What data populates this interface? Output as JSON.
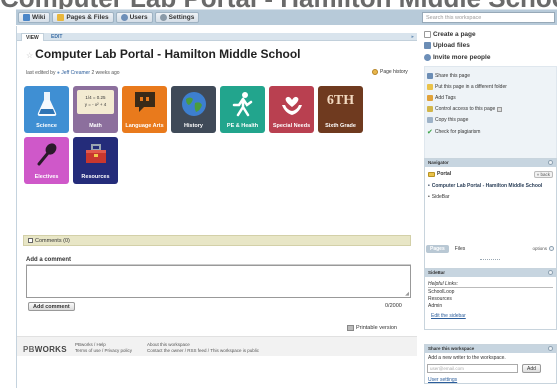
{
  "header": {
    "ghost_text": "Computer Lab Portal - Hamilton Middle School"
  },
  "topbar": {
    "tabs": [
      {
        "label": "Wiki",
        "icon": "wiki-icon",
        "color": "#4a86c8"
      },
      {
        "label": "Pages & Files",
        "icon": "folder-icon",
        "color": "#e9b73b"
      },
      {
        "label": "Users",
        "icon": "users-icon",
        "color": "#6d8fb8"
      },
      {
        "label": "Settings",
        "icon": "settings-icon",
        "color": "#8a9aa8"
      }
    ],
    "search_placeholder": "Search this workspace"
  },
  "view_tabs": {
    "view": "VIEW",
    "edit": "EDIT"
  },
  "page": {
    "title": "Computer Lab Portal - Hamilton Middle School",
    "last_edited_prefix": "last edited by",
    "last_edited_user": "Jeff Creamer",
    "last_edited_when": "2 weeks ago",
    "page_history": "Page history"
  },
  "tiles": [
    {
      "label": "Science",
      "color": "#3f8fd3"
    },
    {
      "label": "Math",
      "color": "#8c6f9d",
      "formula1": "1/4 = 0.25",
      "formula2": "y = - x² + 4"
    },
    {
      "label": "Language Arts",
      "color": "#e97a1c"
    },
    {
      "label": "History",
      "color": "#3f4a58"
    },
    {
      "label": "PE & Health",
      "color": "#22a58d"
    },
    {
      "label": "Special Needs",
      "color": "#b94050"
    },
    {
      "label": "Sixth Grade",
      "color": "#6f3a1f",
      "badge": "6TH"
    },
    {
      "label": "Electives",
      "color": "#cf58c9"
    },
    {
      "label": "Resources",
      "color": "#242c7a"
    }
  ],
  "comments": {
    "bar_label": "Comments (0)",
    "add_title": "Add a comment",
    "add_button": "Add comment",
    "char_count": "0/2000"
  },
  "printable": "Printable version",
  "footer": {
    "logo_pb": "PB",
    "logo_works": "WORKS",
    "col1_line1": "PBworks / Help",
    "col1_line2": "Terms of use / Privacy policy",
    "col2_line1": "About this workspace",
    "col2_line2": "Contact the owner / RSS feed / This workspace is public"
  },
  "sidebar": {
    "create_page": "Create a page",
    "upload_files": "Upload files",
    "invite_people": "Invite more people",
    "page_actions": [
      {
        "label": "Share this page",
        "icon": "share-icon",
        "color": "#6b8db5"
      },
      {
        "label": "Put this page in a different folder",
        "icon": "folder-icon",
        "color": "#e9c24a"
      },
      {
        "label": "Add Tags",
        "icon": "tag-icon",
        "color": "#e0a23a"
      },
      {
        "label": "Control access to this page",
        "icon": "key-icon",
        "color": "#d2b64a"
      },
      {
        "label": "Copy this page",
        "icon": "copy-icon",
        "color": "#9db2c7"
      },
      {
        "label": "Check for plagiarism",
        "icon": "check-icon",
        "color": "#3aa346"
      }
    ],
    "navigator": {
      "title": "Navigator",
      "folder": "Portal",
      "back": "« back",
      "item1": "Computer Lab Portal - Hamilton Middle School",
      "item2": "SideBar"
    },
    "pages_tab": "Pages",
    "files_tab": "Files",
    "options": "options",
    "sidebar_widget": {
      "title": "SideBar",
      "helpful": "Helpful Links:",
      "link1": "SchoolLoop",
      "link2": "Resources",
      "link3": "Admin",
      "edit": "Edit the sidebar"
    },
    "share_widget": {
      "title": "Share this workspace",
      "prompt": "Add a new writer to the workspace.",
      "email_placeholder": "user@email.com",
      "add": "Add",
      "user_settings": "User settings"
    }
  }
}
